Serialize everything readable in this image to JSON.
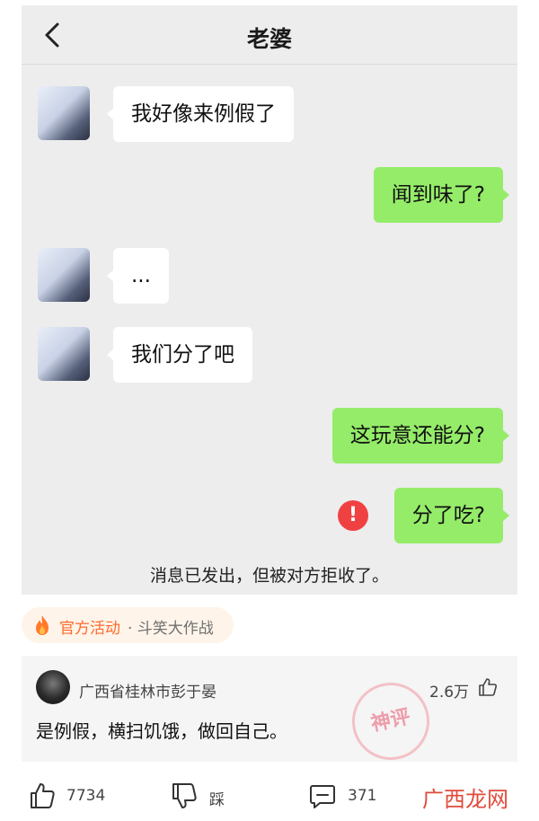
{
  "chat": {
    "title": "老婆",
    "messages": [
      {
        "side": "left",
        "text": "我好像来例假了"
      },
      {
        "side": "right",
        "text": "闻到味了?"
      },
      {
        "side": "left",
        "text": "..."
      },
      {
        "side": "left",
        "text": "我们分了吧"
      },
      {
        "side": "right",
        "text": "这玩意还能分?"
      },
      {
        "side": "right",
        "text": "分了吃?"
      }
    ],
    "error_symbol": "!",
    "rejected_notice": "消息已发出，但被对方拒收了。"
  },
  "activity": {
    "label": "官方活动",
    "name": "· 斗笑大作战"
  },
  "comment": {
    "author": "广西省桂林市彭于晏",
    "likes": "2.6万",
    "text": "是例假，横扫饥饿，做回自己。",
    "stamp_text": "神评"
  },
  "actions": {
    "like_count": "7734",
    "dislike_label": "踩",
    "comment_count": "371"
  },
  "watermark": "广西龙网",
  "colors": {
    "bubble_right": "#95ec69",
    "bubble_left": "#ffffff",
    "error": "#f04142",
    "activity_orange": "#ff6a2a"
  }
}
